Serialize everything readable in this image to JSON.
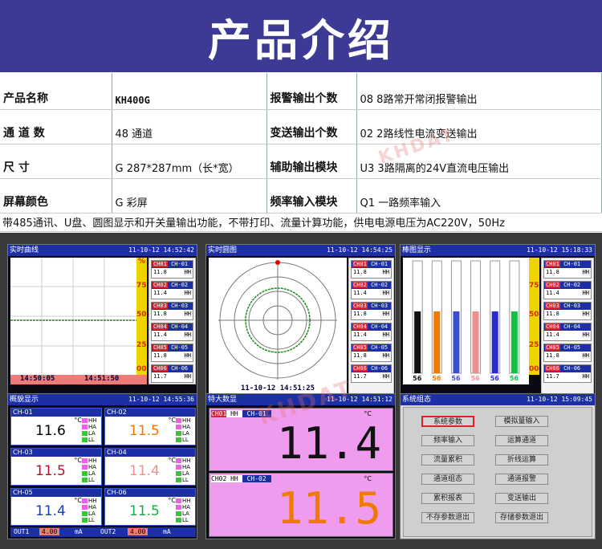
{
  "header": {
    "title": "产品介绍"
  },
  "spec": [
    [
      "产品名称",
      "KH400G",
      "报警输出个数",
      "08  8路常开常闭报警输出"
    ],
    [
      "通 道 数",
      "48 通道",
      "变送输出个数",
      "02  2路线性电流变送输出"
    ],
    [
      "尺   寸",
      "G  287*287mm（长*宽）",
      "辅助输出模块",
      "U3  3路隔离的24V直流电压输出"
    ],
    [
      "屏幕颜色",
      "G  彩屏",
      "频率输入模块",
      "Q1  一路频率输入"
    ]
  ],
  "note": "带485通讯、U盘、圆图显示和开关量输出功能，不带打印、流量计算功能，供电电源电压为AC220V，50Hz",
  "watermark": "KHDAT",
  "colors": {
    "header_bg": "#3d3a95",
    "titlebar": "#1d2fa5",
    "axis": "#efd400",
    "alarm": "#d23"
  },
  "screens": {
    "realtime": {
      "title": "实时曲线",
      "time": "11-10-12 14:52:42",
      "t_start": "14:50:05",
      "t_end": "14:51:50",
      "ticks": [
        "75",
        "50",
        "25",
        "00"
      ],
      "unit": "%"
    },
    "circle": {
      "title": "实时圆图",
      "time": "11-10-12 14:54:25",
      "foot": "11-10-12 14:51:25"
    },
    "bar": {
      "title": "棒图显示",
      "time": "11-10-12 15:18:33",
      "labels": [
        "56",
        "56",
        "56",
        "56",
        "56",
        "56"
      ],
      "ticks": [
        "75",
        "50",
        "25",
        "00"
      ],
      "levels": [
        0.55,
        0.55,
        0.55,
        0.55,
        0.55,
        0.55
      ],
      "bar_colors": [
        "#111111",
        "#f07a00",
        "#3a4fd0",
        "#f08f8f",
        "#2b2bd0",
        "#14c040"
      ]
    },
    "overview": {
      "title": "概貌显示",
      "time": "11-10-12 14:55:36",
      "out1": "OUT1",
      "out1_val": "4.00",
      "out2": "OUT2",
      "out2_val": "4.00",
      "unit_ma": "mA",
      "cells": [
        {
          "ch": "CH-01",
          "val": "11.6",
          "color": "#000000"
        },
        {
          "ch": "CH-02",
          "val": "11.5",
          "color": "#f07a00"
        },
        {
          "ch": "CH-03",
          "val": "11.5",
          "color": "#b01030"
        },
        {
          "ch": "CH-04",
          "val": "11.4",
          "color": "#f08f8f"
        },
        {
          "ch": "CH-05",
          "val": "11.4",
          "color": "#1040c0"
        },
        {
          "ch": "CH-06",
          "val": "11.5",
          "color": "#14b040"
        }
      ],
      "unit": "°C",
      "legend": [
        "HH",
        "HA",
        "LA",
        "LL"
      ]
    },
    "bignum": {
      "title": "特大数显",
      "time": "11-10-12 14:51:12",
      "rows": [
        {
          "ch": "CH01",
          "tag": "HH",
          "name": "CH-01",
          "val": "11.4",
          "color": "#000000"
        },
        {
          "ch": "CH02",
          "tag": "HH",
          "name": "CH-02",
          "val": "11.5",
          "color": "#f07a00"
        }
      ],
      "unit": "°C"
    },
    "sys": {
      "title": "系统组态",
      "time": "11-10-12 15:09:45",
      "buttons": [
        "系统参数",
        "模拟量输入",
        "频率输入",
        "运算通道",
        "流量累积",
        "折线运算",
        "通道组态",
        "通道报警",
        "累积报表",
        "变送输出",
        "不存参数退出",
        "存储参数退出"
      ]
    }
  },
  "chips": [
    {
      "c": "CH01",
      "n": "CH-01",
      "v": "11.8"
    },
    {
      "c": "CH02",
      "n": "CH-02",
      "v": "11.4"
    },
    {
      "c": "CH03",
      "n": "CH-03",
      "v": "11.8"
    },
    {
      "c": "CH04",
      "n": "CH-04",
      "v": "11.4"
    },
    {
      "c": "CH05",
      "n": "CH-05",
      "v": "11.8"
    },
    {
      "c": "CH06",
      "n": "CH-06",
      "v": "11.7"
    }
  ],
  "chip_tag": "HH"
}
